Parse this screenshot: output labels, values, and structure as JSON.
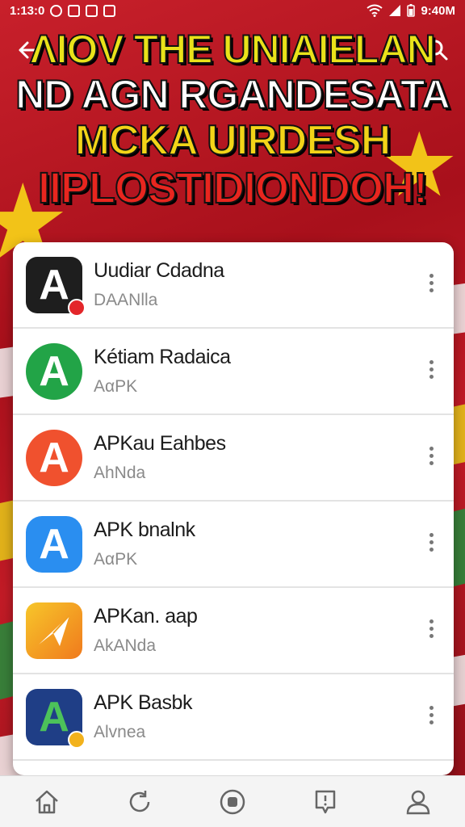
{
  "status_bar": {
    "time": "1:13:0",
    "right_text": "9:40M",
    "left_icons": [
      "sync-icon",
      "image-icon",
      "notification-icon",
      "app-icon"
    ],
    "right_icons": [
      "wifi-icon",
      "signal-icon",
      "battery-icon"
    ]
  },
  "top_bar": {
    "back_icon": "back-arrow-icon",
    "search_icon": "search-icon"
  },
  "headline": {
    "line1": "ΛIOV THE UNIAIELAN",
    "line2": "ND AGN RGANDESATA",
    "line3": "MCKA  UIRDESH",
    "line4": "IIPLOSTIDIONDOH!"
  },
  "apps": [
    {
      "name": "Uudiar Cdadna",
      "subtitle": "DAANlla",
      "icon_color": "#1e1e1e",
      "icon": "a-logo-icon"
    },
    {
      "name": "Kétiam Radaica",
      "subtitle": "AαPK",
      "icon_color": "#22a447",
      "icon": "a-logo-icon"
    },
    {
      "name": "APKau Eahbes",
      "subtitle": "AhNda",
      "icon_color": "#f0512e",
      "icon": "a-logo-icon"
    },
    {
      "name": "APK bnalnk",
      "subtitle": "AαPK",
      "icon_color": "#2a8ef0",
      "icon": "a-logo-icon"
    },
    {
      "name": "APKan. aap",
      "subtitle": "AkANda",
      "icon_color": "#f5a81d",
      "icon": "paper-plane-icon"
    },
    {
      "name": "APK Basbk",
      "subtitle": "Alvnea",
      "icon_color": "#1f3e86",
      "icon": "a-logo-icon"
    }
  ],
  "bottom_nav": [
    "home-icon",
    "refresh-icon",
    "record-icon",
    "message-icon",
    "profile-icon"
  ],
  "colors": {
    "background_red": "#b3121f",
    "headline_yellow": "#f2d418",
    "headline_red": "#e8261f"
  }
}
